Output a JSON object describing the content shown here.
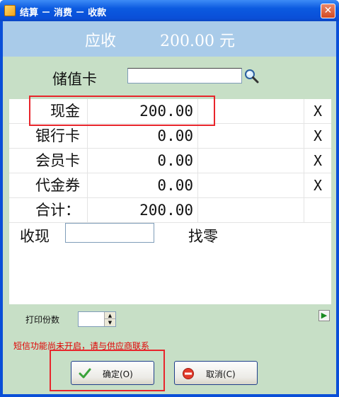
{
  "window": {
    "title": "结算 － 消费 － 收款",
    "close_glyph": "✕"
  },
  "header": {
    "label": "应收",
    "amount": "200.00 元"
  },
  "stored_value": {
    "label": "储值卡",
    "value": "",
    "search_icon": "magnifier-icon"
  },
  "payments": [
    {
      "label": "现金",
      "amount": "200.00",
      "clear": "X"
    },
    {
      "label": "银行卡",
      "amount": "0.00",
      "clear": "X"
    },
    {
      "label": "会员卡",
      "amount": "0.00",
      "clear": "X"
    },
    {
      "label": "代金券",
      "amount": "0.00",
      "clear": "X"
    }
  ],
  "total": {
    "label": "合计：",
    "amount": "200.00"
  },
  "cash_received": {
    "label": "收现",
    "value": ""
  },
  "change": {
    "label": "找零"
  },
  "print": {
    "label": "打印份数",
    "value": ""
  },
  "sms_notice": "短信功能尚未开启，请与供应商联系",
  "buttons": {
    "ok": "确定(O)",
    "cancel": "取消(C)"
  },
  "colors": {
    "title_bar": "#0a4fd8",
    "client_bg": "#c7dfc6",
    "amount_bar": "#a9cbe9",
    "highlight": "#e8252b",
    "notice": "#e00000"
  }
}
